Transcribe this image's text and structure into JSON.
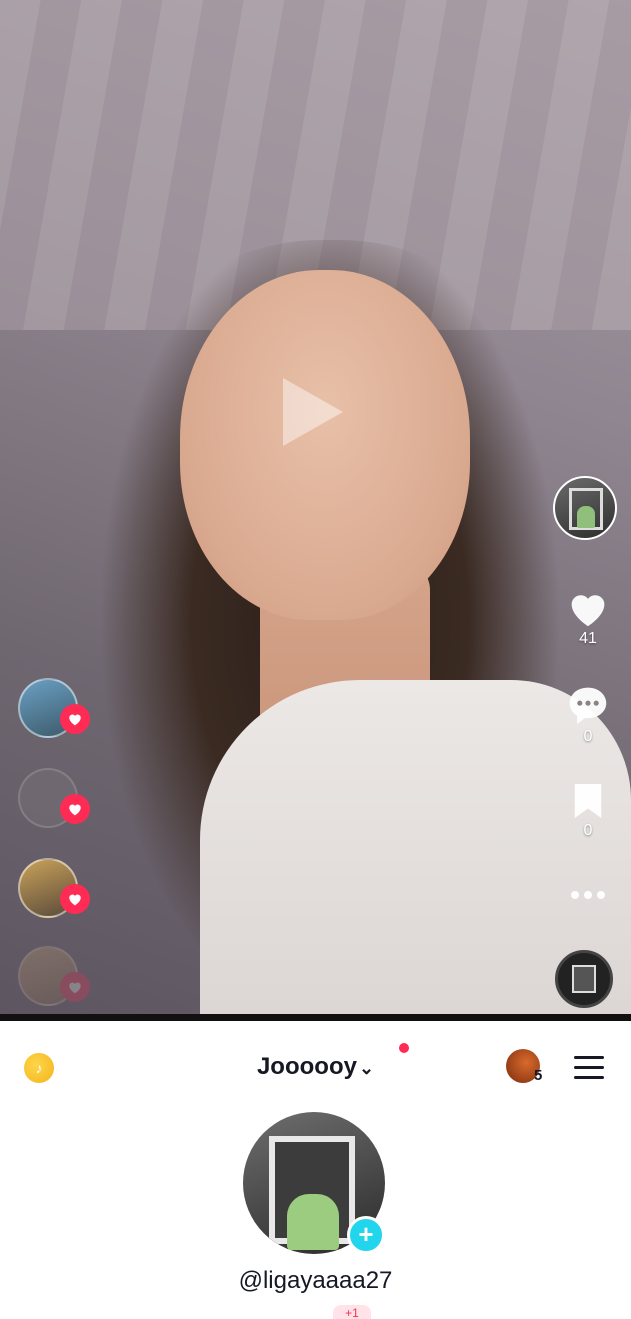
{
  "video": {
    "actions": {
      "likes": "41",
      "comments": "0",
      "saves": "0"
    }
  },
  "profile": {
    "nickname": "Joooooy",
    "handle": "@ligayaaaa27",
    "friends_count": "5",
    "badge": "+1"
  },
  "colors": {
    "accent": "#fe2c55",
    "add_button": "#20d5ec",
    "coin": "#f2b51b"
  }
}
